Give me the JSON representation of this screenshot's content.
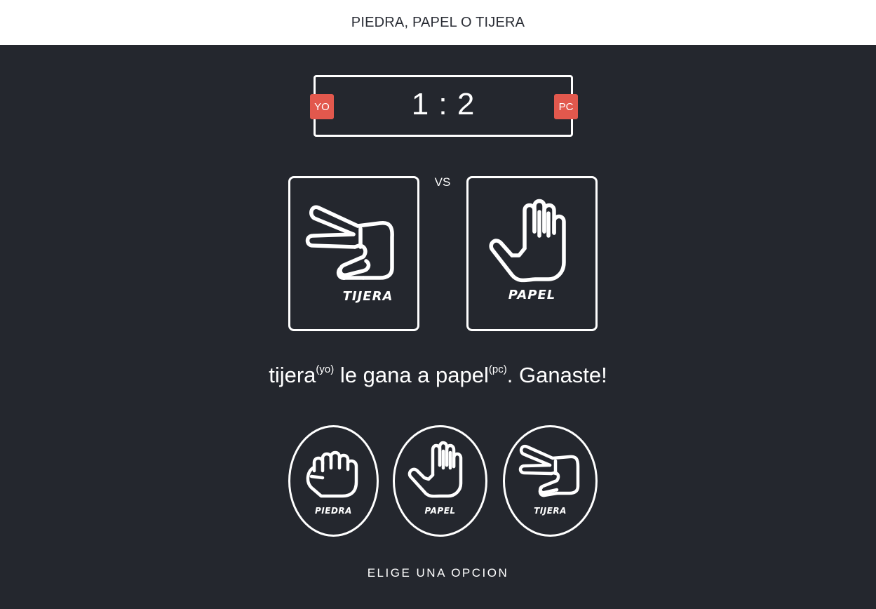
{
  "header": {
    "title": "PIEDRA, PAPEL O TIJERA"
  },
  "scoreboard": {
    "user_badge": "YO",
    "computer_badge": "PC",
    "score": "1 : 2"
  },
  "versus_label": "VS",
  "user_choice": {
    "icon": "scissors-hand-icon",
    "label": "TIJERA"
  },
  "computer_choice": {
    "icon": "open-hand-icon",
    "label": "PAPEL"
  },
  "result": {
    "user_word": "tijera",
    "user_tag": "(yo)",
    "middle": " le gana a ",
    "computer_word": "papel",
    "computer_tag": "(pc)",
    "outcome": ". Ganaste!"
  },
  "options": [
    {
      "id": "rock",
      "icon": "fist-icon",
      "label": "PIEDRA"
    },
    {
      "id": "paper",
      "icon": "open-hand-icon",
      "label": "PAPEL"
    },
    {
      "id": "scissors",
      "icon": "scissors-hand-icon",
      "label": "TIJERA"
    }
  ],
  "prompt": "ELIGE UNA OPCION",
  "colors": {
    "background": "#24272e",
    "badge": "#e2584d",
    "foreground": "#ffffff"
  }
}
